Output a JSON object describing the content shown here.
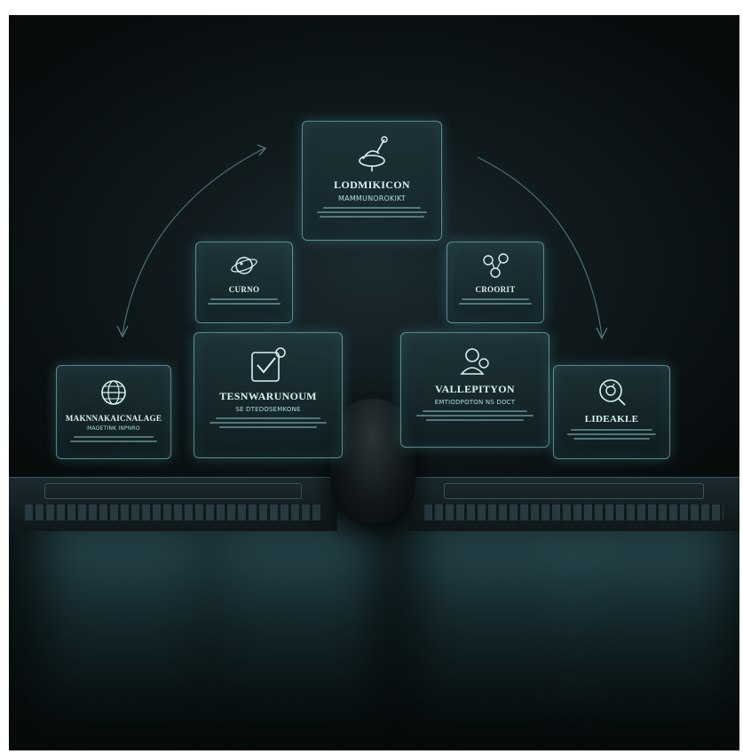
{
  "panels": {
    "top": {
      "title": "LODMIKICON",
      "subtitle": "MAMMUNOROKIKT"
    },
    "small_left": {
      "title": "CURNO"
    },
    "small_right": {
      "title": "CROORIT"
    },
    "mid_left": {
      "title": "TESNWARUNOUM",
      "subtitle": "SE DTEDOSEMKONE"
    },
    "mid_right": {
      "title": "VALLEPITYON",
      "subtitle": "EMTIODPOTON NS DOCT"
    },
    "far_left": {
      "title": "MAKNNAKAICNALAGE",
      "subtitle": "MAOETINK INPNRO"
    },
    "far_right": {
      "title": "LIDEAKLE"
    }
  },
  "icons": [
    "dish-icon",
    "planet-icon",
    "molecule-icon",
    "checklist-icon",
    "person-icon",
    "globe-icon",
    "gear-icon"
  ],
  "colors": {
    "accent": "#8fdde4",
    "background": "#0c1416"
  }
}
